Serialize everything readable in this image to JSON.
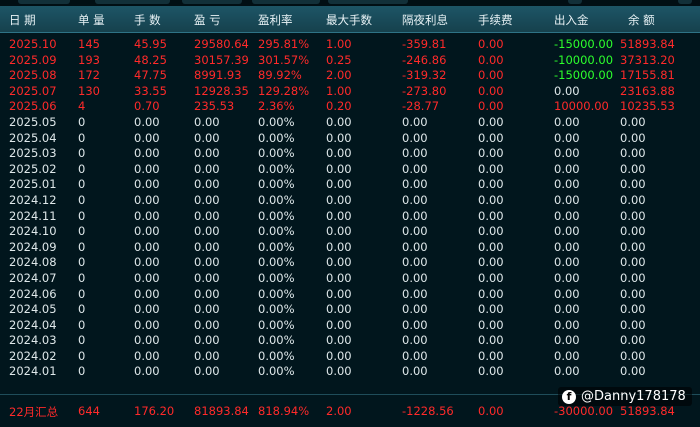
{
  "columns": [
    "日 期",
    "单 量",
    "手 数",
    "盈 亏",
    "盈利率",
    "最大手数",
    "隔夜利息",
    "手续费",
    "出入金",
    "余 额"
  ],
  "rows": [
    {
      "date": "2025.10",
      "orders": "145",
      "lots": "45.95",
      "pnl": "29580.64",
      "rate": "295.81%",
      "max_lots": "1.00",
      "swap": "-359.81",
      "fee": "0.00",
      "flow": "-15000.00",
      "balance": "51893.84",
      "color": "red",
      "flow_color": "green"
    },
    {
      "date": "2025.09",
      "orders": "193",
      "lots": "48.25",
      "pnl": "30157.39",
      "rate": "301.57%",
      "max_lots": "0.25",
      "swap": "-246.86",
      "fee": "0.00",
      "flow": "-10000.00",
      "balance": "37313.20",
      "color": "red",
      "flow_color": "green"
    },
    {
      "date": "2025.08",
      "orders": "172",
      "lots": "47.75",
      "pnl": "8991.93",
      "rate": "89.92%",
      "max_lots": "2.00",
      "swap": "-319.32",
      "fee": "0.00",
      "flow": "-15000.00",
      "balance": "17155.81",
      "color": "red",
      "flow_color": "green"
    },
    {
      "date": "2025.07",
      "orders": "130",
      "lots": "33.55",
      "pnl": "12928.35",
      "rate": "129.28%",
      "max_lots": "1.00",
      "swap": "-273.80",
      "fee": "0.00",
      "flow": "0.00",
      "balance": "23163.88",
      "color": "red",
      "flow_color": "white"
    },
    {
      "date": "2025.06",
      "orders": "4",
      "lots": "0.70",
      "pnl": "235.53",
      "rate": "2.36%",
      "max_lots": "0.20",
      "swap": "-28.77",
      "fee": "0.00",
      "flow": "10000.00",
      "balance": "10235.53",
      "color": "red",
      "flow_color": "red"
    },
    {
      "date": "2025.05",
      "orders": "0",
      "lots": "0.00",
      "pnl": "0.00",
      "rate": "0.00%",
      "max_lots": "0.00",
      "swap": "0.00",
      "fee": "0.00",
      "flow": "0.00",
      "balance": "0.00",
      "color": "white",
      "flow_color": "white"
    },
    {
      "date": "2025.04",
      "orders": "0",
      "lots": "0.00",
      "pnl": "0.00",
      "rate": "0.00%",
      "max_lots": "0.00",
      "swap": "0.00",
      "fee": "0.00",
      "flow": "0.00",
      "balance": "0.00",
      "color": "white",
      "flow_color": "white"
    },
    {
      "date": "2025.03",
      "orders": "0",
      "lots": "0.00",
      "pnl": "0.00",
      "rate": "0.00%",
      "max_lots": "0.00",
      "swap": "0.00",
      "fee": "0.00",
      "flow": "0.00",
      "balance": "0.00",
      "color": "white",
      "flow_color": "white"
    },
    {
      "date": "2025.02",
      "orders": "0",
      "lots": "0.00",
      "pnl": "0.00",
      "rate": "0.00%",
      "max_lots": "0.00",
      "swap": "0.00",
      "fee": "0.00",
      "flow": "0.00",
      "balance": "0.00",
      "color": "white",
      "flow_color": "white"
    },
    {
      "date": "2025.01",
      "orders": "0",
      "lots": "0.00",
      "pnl": "0.00",
      "rate": "0.00%",
      "max_lots": "0.00",
      "swap": "0.00",
      "fee": "0.00",
      "flow": "0.00",
      "balance": "0.00",
      "color": "white",
      "flow_color": "white"
    },
    {
      "date": "2024.12",
      "orders": "0",
      "lots": "0.00",
      "pnl": "0.00",
      "rate": "0.00%",
      "max_lots": "0.00",
      "swap": "0.00",
      "fee": "0.00",
      "flow": "0.00",
      "balance": "0.00",
      "color": "white",
      "flow_color": "white"
    },
    {
      "date": "2024.11",
      "orders": "0",
      "lots": "0.00",
      "pnl": "0.00",
      "rate": "0.00%",
      "max_lots": "0.00",
      "swap": "0.00",
      "fee": "0.00",
      "flow": "0.00",
      "balance": "0.00",
      "color": "white",
      "flow_color": "white"
    },
    {
      "date": "2024.10",
      "orders": "0",
      "lots": "0.00",
      "pnl": "0.00",
      "rate": "0.00%",
      "max_lots": "0.00",
      "swap": "0.00",
      "fee": "0.00",
      "flow": "0.00",
      "balance": "0.00",
      "color": "white",
      "flow_color": "white"
    },
    {
      "date": "2024.09",
      "orders": "0",
      "lots": "0.00",
      "pnl": "0.00",
      "rate": "0.00%",
      "max_lots": "0.00",
      "swap": "0.00",
      "fee": "0.00",
      "flow": "0.00",
      "balance": "0.00",
      "color": "white",
      "flow_color": "white"
    },
    {
      "date": "2024.08",
      "orders": "0",
      "lots": "0.00",
      "pnl": "0.00",
      "rate": "0.00%",
      "max_lots": "0.00",
      "swap": "0.00",
      "fee": "0.00",
      "flow": "0.00",
      "balance": "0.00",
      "color": "white",
      "flow_color": "white"
    },
    {
      "date": "2024.07",
      "orders": "0",
      "lots": "0.00",
      "pnl": "0.00",
      "rate": "0.00%",
      "max_lots": "0.00",
      "swap": "0.00",
      "fee": "0.00",
      "flow": "0.00",
      "balance": "0.00",
      "color": "white",
      "flow_color": "white"
    },
    {
      "date": "2024.06",
      "orders": "0",
      "lots": "0.00",
      "pnl": "0.00",
      "rate": "0.00%",
      "max_lots": "0.00",
      "swap": "0.00",
      "fee": "0.00",
      "flow": "0.00",
      "balance": "0.00",
      "color": "white",
      "flow_color": "white"
    },
    {
      "date": "2024.05",
      "orders": "0",
      "lots": "0.00",
      "pnl": "0.00",
      "rate": "0.00%",
      "max_lots": "0.00",
      "swap": "0.00",
      "fee": "0.00",
      "flow": "0.00",
      "balance": "0.00",
      "color": "white",
      "flow_color": "white"
    },
    {
      "date": "2024.04",
      "orders": "0",
      "lots": "0.00",
      "pnl": "0.00",
      "rate": "0.00%",
      "max_lots": "0.00",
      "swap": "0.00",
      "fee": "0.00",
      "flow": "0.00",
      "balance": "0.00",
      "color": "white",
      "flow_color": "white"
    },
    {
      "date": "2024.03",
      "orders": "0",
      "lots": "0.00",
      "pnl": "0.00",
      "rate": "0.00%",
      "max_lots": "0.00",
      "swap": "0.00",
      "fee": "0.00",
      "flow": "0.00",
      "balance": "0.00",
      "color": "white",
      "flow_color": "white"
    },
    {
      "date": "2024.02",
      "orders": "0",
      "lots": "0.00",
      "pnl": "0.00",
      "rate": "0.00%",
      "max_lots": "0.00",
      "swap": "0.00",
      "fee": "0.00",
      "flow": "0.00",
      "balance": "0.00",
      "color": "white",
      "flow_color": "white"
    },
    {
      "date": "2024.01",
      "orders": "0",
      "lots": "0.00",
      "pnl": "0.00",
      "rate": "0.00%",
      "max_lots": "0.00",
      "swap": "0.00",
      "fee": "0.00",
      "flow": "0.00",
      "balance": "0.00",
      "color": "white",
      "flow_color": "white"
    }
  ],
  "summary": {
    "date": "22月汇总",
    "orders": "644",
    "lots": "176.20",
    "pnl": "81893.84",
    "rate": "818.94%",
    "max_lots": "2.00",
    "swap": "-1228.56",
    "fee": "0.00",
    "flow": "-30000.00",
    "balance": "51893.84",
    "color": "red",
    "flow_color": "red"
  },
  "watermark": {
    "text": "@Danny178178",
    "icon": "facebook-icon"
  },
  "colors": {
    "background": "#01161d",
    "header": "#1d5566",
    "positive_red": "#ff2a2a",
    "negative_green": "#2cff2c",
    "neutral": "#dfe8ea"
  }
}
